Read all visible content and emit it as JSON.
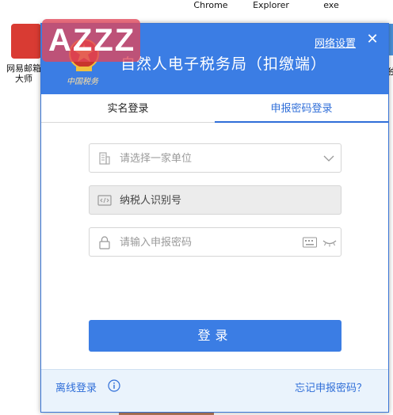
{
  "desktop": {
    "top_labels": [
      "Chrome",
      "Explorer",
      "exe"
    ],
    "left_label": "网易邮箱\n大师",
    "right_label": "独"
  },
  "watermark": {
    "text": "AZZZ"
  },
  "header": {
    "logo_text": "中国税务",
    "title": "自然人电子税务局（扣缴端）",
    "network_link": "网络设置",
    "close_symbol": "✕",
    "color": "#3b7de4"
  },
  "tabs": [
    {
      "label": "实名登录",
      "active": false
    },
    {
      "label": "申报密码登录",
      "active": true
    }
  ],
  "form": {
    "unit_placeholder": "请选择一家单位",
    "taxpayer_id_value": "纳税人识别号",
    "password_placeholder": "请输入申报密码",
    "login_label": "登录"
  },
  "footer": {
    "offline_login": "离线登录",
    "forgot_password": "忘记申报密码？"
  },
  "accent_color": "#2f6ed8"
}
